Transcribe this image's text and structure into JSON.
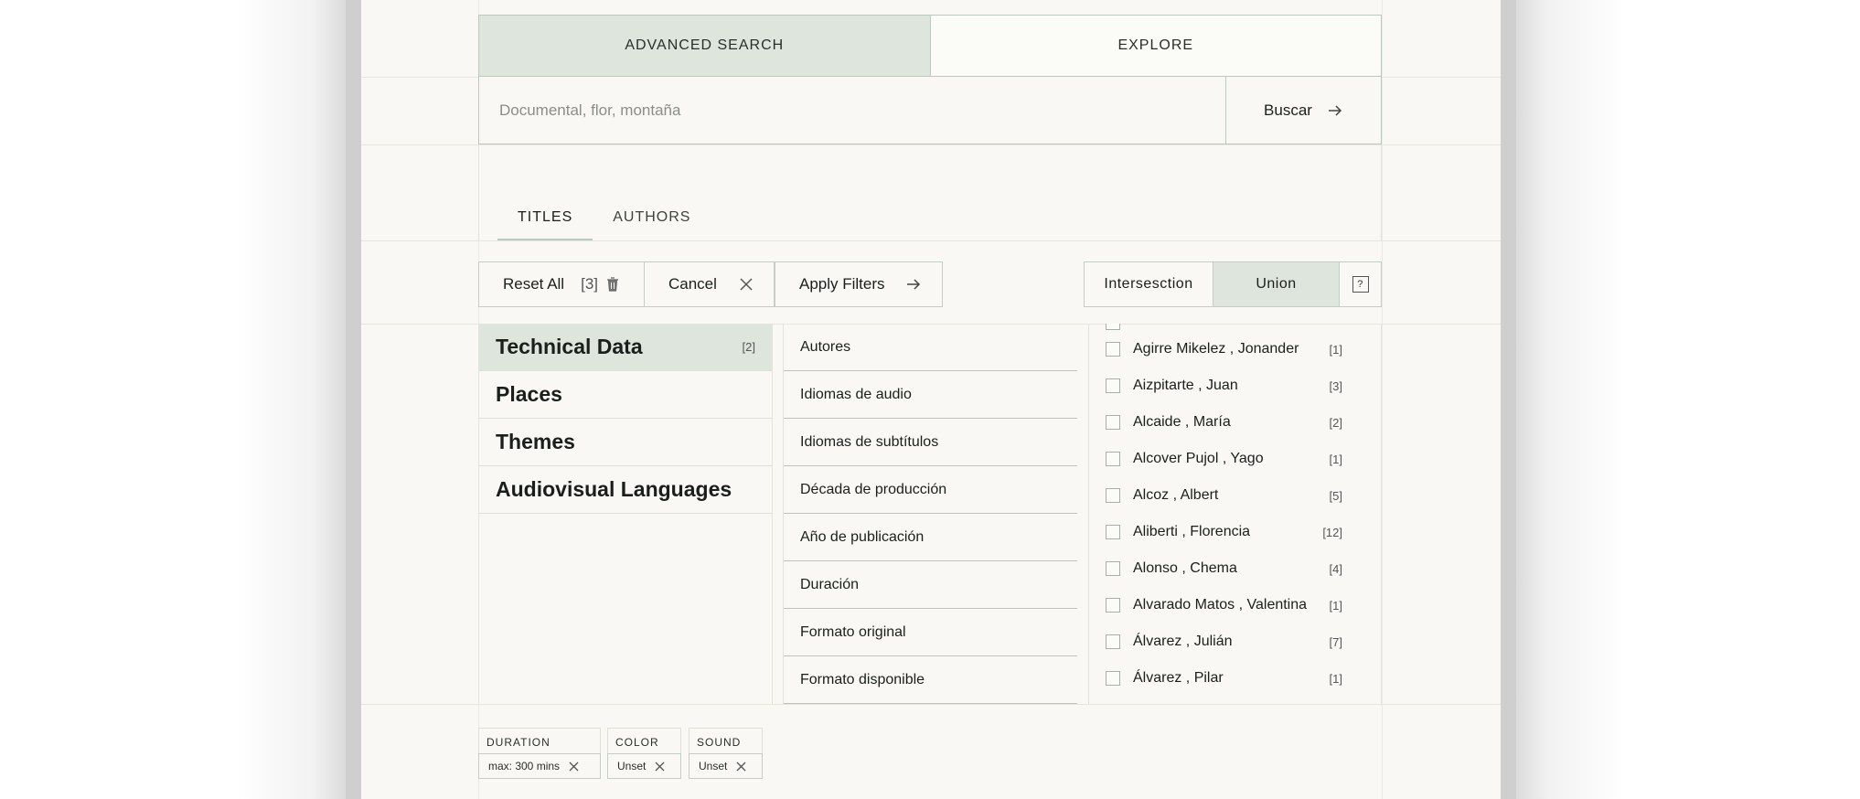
{
  "search_tabs": {
    "advanced": "ADVANCED SEARCH",
    "explore": "EXPLORE"
  },
  "search": {
    "placeholder": "Documental, flor, montaña",
    "button": "Buscar"
  },
  "mode_tabs": {
    "titles": "TITLES",
    "authors": "AUTHORS"
  },
  "actions": {
    "reset": "Reset All",
    "reset_count": "[3]",
    "cancel": "Cancel",
    "apply": "Apply Filters"
  },
  "logic": {
    "intersection": "Intersesction",
    "union": "Union",
    "help": "?"
  },
  "categories": [
    {
      "label": "Technical Data",
      "count": "[2]"
    },
    {
      "label": "Places",
      "count": ""
    },
    {
      "label": "Themes",
      "count": ""
    },
    {
      "label": "Audiovisual Languages",
      "count": ""
    }
  ],
  "subcategories": [
    "Autores",
    "Idiomas de audio",
    "Idiomas de subtítulos",
    "Década de producción",
    "Año de publicación",
    "Duración",
    "Formato original",
    "Formato disponible"
  ],
  "options": [
    {
      "label": "Agirre Mikelez , Jonander",
      "count": "[1]"
    },
    {
      "label": "Aizpitarte , Juan",
      "count": "[3]"
    },
    {
      "label": "Alcaide , María",
      "count": "[2]"
    },
    {
      "label": "Alcover Pujol , Yago",
      "count": "[1]"
    },
    {
      "label": "Alcoz , Albert",
      "count": "[5]"
    },
    {
      "label": "Aliberti , Florencia",
      "count": "[12]"
    },
    {
      "label": "Alonso , Chema",
      "count": "[4]"
    },
    {
      "label": "Alvarado Matos , Valentina",
      "count": "[1]"
    },
    {
      "label": "Álvarez , Julián",
      "count": "[7]"
    },
    {
      "label": "Álvarez , Pilar",
      "count": "[1]"
    }
  ],
  "active_filters": [
    {
      "label": "DURATION",
      "value": "max: 300 mins"
    },
    {
      "label": "COLOR",
      "value": "Unset"
    },
    {
      "label": "SOUND",
      "value": "Unset"
    }
  ]
}
